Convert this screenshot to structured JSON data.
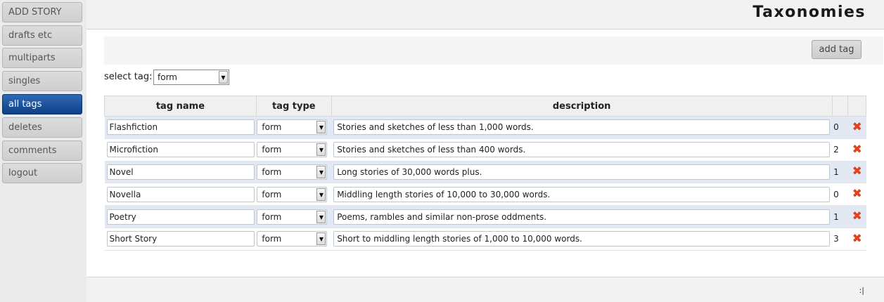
{
  "sidebar": {
    "items": [
      {
        "label": "ADD STORY"
      },
      {
        "label": "drafts etc"
      },
      {
        "label": "multiparts"
      },
      {
        "label": "singles"
      },
      {
        "label": "all tags"
      },
      {
        "label": "deletes"
      },
      {
        "label": "comments"
      },
      {
        "label": "logout"
      }
    ],
    "active": "all tags"
  },
  "header": {
    "title": "Taxonomies"
  },
  "toolbar": {
    "add_tag_label": "add tag"
  },
  "filter": {
    "label": "select tag:",
    "selected": "form"
  },
  "table": {
    "columns": [
      "tag name",
      "tag type",
      "description",
      "",
      ""
    ],
    "rows": [
      {
        "name": "Flashfiction",
        "type": "form",
        "description": "Stories and sketches of less than 1,000 words.",
        "count": "0"
      },
      {
        "name": "Microfiction",
        "type": "form",
        "description": "Stories and sketches of less than 400 words.",
        "count": "2"
      },
      {
        "name": "Novel",
        "type": "form",
        "description": "Long stories of 30,000 words plus.",
        "count": "1"
      },
      {
        "name": "Novella",
        "type": "form",
        "description": "Middling length stories of 10,000 to 30,000 words.",
        "count": "0"
      },
      {
        "name": "Poetry",
        "type": "form",
        "description": "Poems, rambles and similar non-prose oddments.",
        "count": "1"
      },
      {
        "name": "Short Story",
        "type": "form",
        "description": "Short to middling length stories of 1,000 to 10,000 words.",
        "count": "3"
      }
    ]
  },
  "footer": {
    "mark": ":|"
  },
  "icons": {
    "delete": "delete-x-icon",
    "dropdown": "dropdown-arrow-icon"
  },
  "colors": {
    "active_nav": "#1a4e99",
    "delete": "#e2421b",
    "row_highlight": "#e3e9f4"
  }
}
